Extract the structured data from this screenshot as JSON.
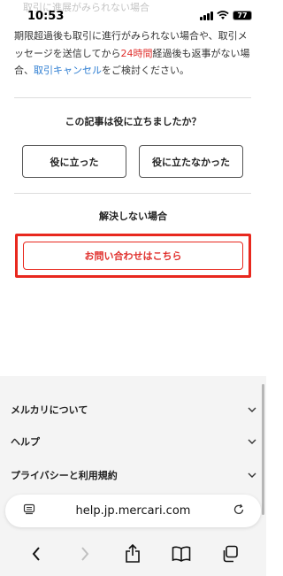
{
  "status_bar": {
    "faded_text": "取引に進展がみられない場合",
    "time": "10:53",
    "battery": "77"
  },
  "article": {
    "para_part1": "期限超過後も取引に進行がみられない場合や、取引メッセージを送信してから",
    "para_highlight": "24時間",
    "para_part2": "経過後も返事がない場合、",
    "para_link": "取引キャンセル",
    "para_part3": "をご検討ください。"
  },
  "feedback": {
    "question": "この記事は役に立ちましたか？",
    "yes_label": "役に立った",
    "no_label": "役に立たなかった"
  },
  "support": {
    "heading": "解決しない場合",
    "contact_label": "お問い合わせはこちら"
  },
  "footer": {
    "items": [
      {
        "label": "メルカリについて"
      },
      {
        "label": "ヘルプ"
      },
      {
        "label": "プライバシーと利用規約"
      }
    ]
  },
  "browser": {
    "url": "help.jp.mercari.com"
  },
  "colors": {
    "accent_red": "#e8281e",
    "link_blue": "#2d7dd2"
  }
}
